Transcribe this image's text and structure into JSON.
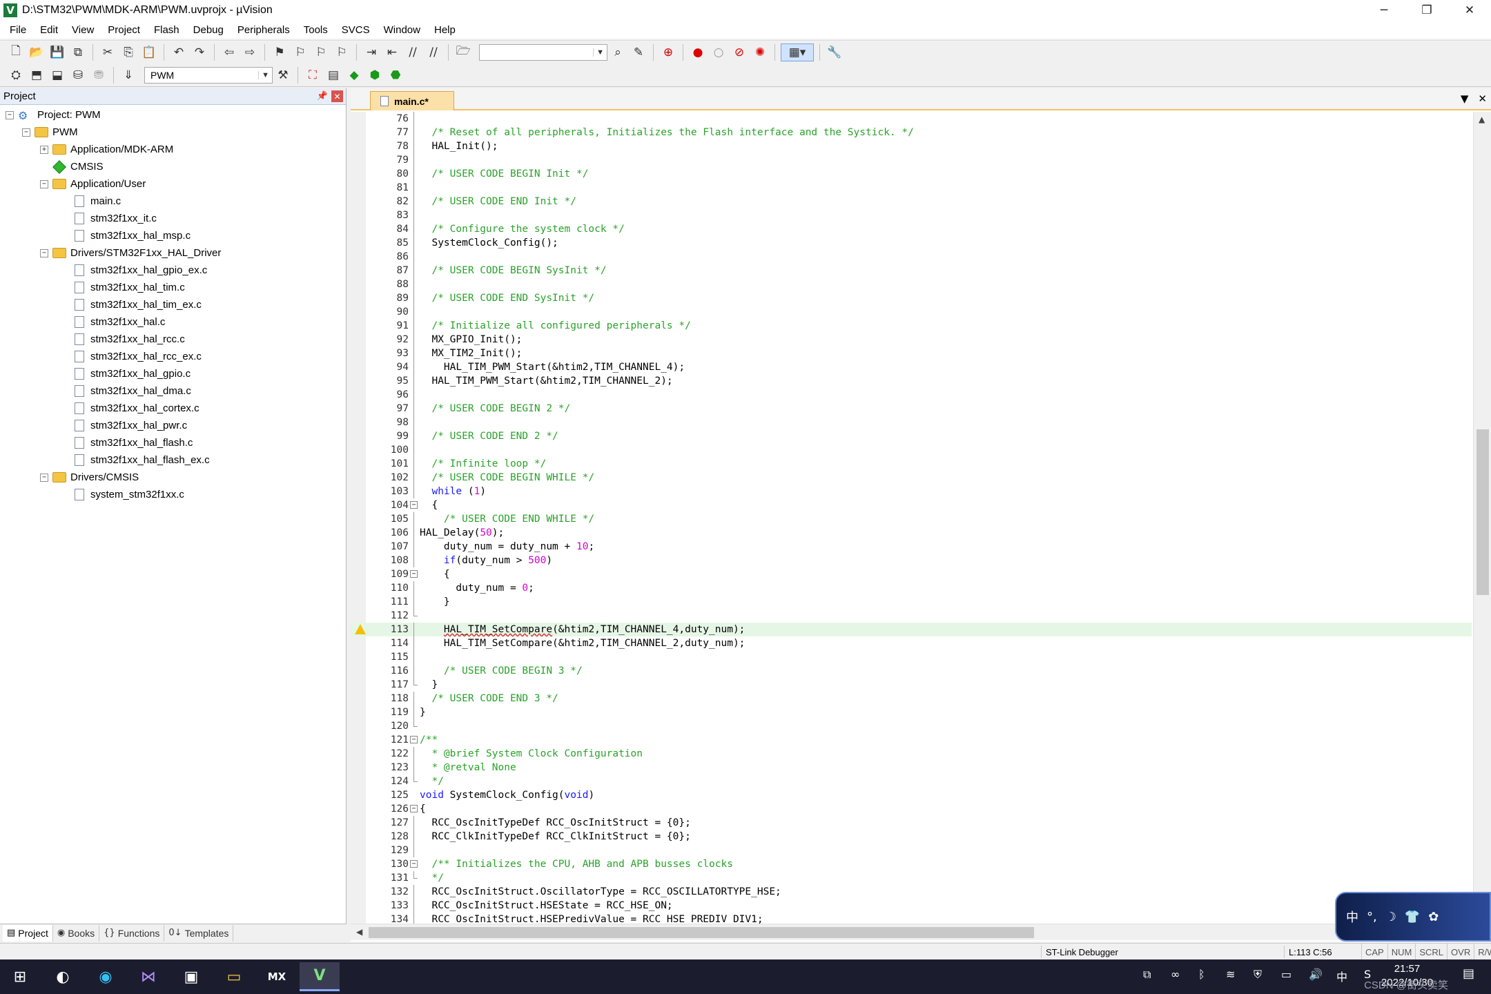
{
  "window": {
    "title": "D:\\STM32\\PWM\\MDK-ARM\\PWM.uvprojx - µVision",
    "app_icon": "V",
    "minimize": "─",
    "restore": "❐",
    "close": "✕"
  },
  "menu": [
    "File",
    "Edit",
    "View",
    "Project",
    "Flash",
    "Debug",
    "Peripherals",
    "Tools",
    "SVCS",
    "Window",
    "Help"
  ],
  "toolbar2": {
    "target": "PWM"
  },
  "project_panel": {
    "title": "Project",
    "tree": [
      {
        "label": "Project: PWM",
        "level": 0,
        "kind": "project",
        "exp": "−"
      },
      {
        "label": "PWM",
        "level": 1,
        "kind": "folder",
        "exp": "−"
      },
      {
        "label": "Application/MDK-ARM",
        "level": 2,
        "kind": "folder",
        "exp": "+"
      },
      {
        "label": "CMSIS",
        "level": 2,
        "kind": "cmsis",
        "exp": ""
      },
      {
        "label": "Application/User",
        "level": 2,
        "kind": "folder",
        "exp": "−"
      },
      {
        "label": "main.c",
        "level": 3,
        "kind": "file",
        "exp": ""
      },
      {
        "label": "stm32f1xx_it.c",
        "level": 3,
        "kind": "file",
        "exp": ""
      },
      {
        "label": "stm32f1xx_hal_msp.c",
        "level": 3,
        "kind": "file",
        "exp": ""
      },
      {
        "label": "Drivers/STM32F1xx_HAL_Driver",
        "level": 2,
        "kind": "folder",
        "exp": "−"
      },
      {
        "label": "stm32f1xx_hal_gpio_ex.c",
        "level": 3,
        "kind": "file",
        "exp": ""
      },
      {
        "label": "stm32f1xx_hal_tim.c",
        "level": 3,
        "kind": "file",
        "exp": ""
      },
      {
        "label": "stm32f1xx_hal_tim_ex.c",
        "level": 3,
        "kind": "file",
        "exp": ""
      },
      {
        "label": "stm32f1xx_hal.c",
        "level": 3,
        "kind": "file",
        "exp": ""
      },
      {
        "label": "stm32f1xx_hal_rcc.c",
        "level": 3,
        "kind": "file",
        "exp": ""
      },
      {
        "label": "stm32f1xx_hal_rcc_ex.c",
        "level": 3,
        "kind": "file",
        "exp": ""
      },
      {
        "label": "stm32f1xx_hal_gpio.c",
        "level": 3,
        "kind": "file",
        "exp": ""
      },
      {
        "label": "stm32f1xx_hal_dma.c",
        "level": 3,
        "kind": "file",
        "exp": ""
      },
      {
        "label": "stm32f1xx_hal_cortex.c",
        "level": 3,
        "kind": "file",
        "exp": ""
      },
      {
        "label": "stm32f1xx_hal_pwr.c",
        "level": 3,
        "kind": "file",
        "exp": ""
      },
      {
        "label": "stm32f1xx_hal_flash.c",
        "level": 3,
        "kind": "file",
        "exp": ""
      },
      {
        "label": "stm32f1xx_hal_flash_ex.c",
        "level": 3,
        "kind": "file",
        "exp": ""
      },
      {
        "label": "Drivers/CMSIS",
        "level": 2,
        "kind": "folder",
        "exp": "−"
      },
      {
        "label": "system_stm32f1xx.c",
        "level": 3,
        "kind": "file",
        "exp": ""
      }
    ],
    "tabs": [
      {
        "label": "Project",
        "icon": "▤"
      },
      {
        "label": "Books",
        "icon": "◉"
      },
      {
        "label": "Functions",
        "icon": "{}"
      },
      {
        "label": "Templates",
        "icon": "0↓"
      }
    ]
  },
  "editor": {
    "tab_label": "main.c*",
    "lines": [
      {
        "n": "76",
        "t": "",
        "c": "code",
        "f": "line"
      },
      {
        "n": "77",
        "t": "  /* Reset of all peripherals, Initializes the Flash interface and the Systick. */",
        "c": "cmt",
        "f": "line"
      },
      {
        "n": "78",
        "t": "  HAL_Init();",
        "c": "code",
        "f": "line"
      },
      {
        "n": "79",
        "t": "",
        "c": "code",
        "f": "line"
      },
      {
        "n": "80",
        "t": "  /* USER CODE BEGIN Init */",
        "c": "cmt",
        "f": "line"
      },
      {
        "n": "81",
        "t": "",
        "c": "code",
        "f": "line"
      },
      {
        "n": "82",
        "t": "  /* USER CODE END Init */",
        "c": "cmt",
        "f": "line"
      },
      {
        "n": "83",
        "t": "",
        "c": "code",
        "f": "line"
      },
      {
        "n": "84",
        "t": "  /* Configure the system clock */",
        "c": "cmt",
        "f": "line"
      },
      {
        "n": "85",
        "t": "  SystemClock_Config();",
        "c": "code",
        "f": "line"
      },
      {
        "n": "86",
        "t": "",
        "c": "code",
        "f": "line"
      },
      {
        "n": "87",
        "t": "  /* USER CODE BEGIN SysInit */",
        "c": "cmt",
        "f": "line"
      },
      {
        "n": "88",
        "t": "",
        "c": "code",
        "f": "line"
      },
      {
        "n": "89",
        "t": "  /* USER CODE END SysInit */",
        "c": "cmt",
        "f": "line"
      },
      {
        "n": "90",
        "t": "",
        "c": "code",
        "f": "line"
      },
      {
        "n": "91",
        "t": "  /* Initialize all configured peripherals */",
        "c": "cmt",
        "f": "line"
      },
      {
        "n": "92",
        "t": "  MX_GPIO_Init();",
        "c": "code",
        "f": "line"
      },
      {
        "n": "93",
        "t": "  MX_TIM2_Init();",
        "c": "code",
        "f": "line"
      },
      {
        "n": "94",
        "t": "    HAL_TIM_PWM_Start(&htim2,TIM_CHANNEL_4);",
        "c": "code",
        "f": "line"
      },
      {
        "n": "95",
        "t": "  HAL_TIM_PWM_Start(&htim2,TIM_CHANNEL_2);",
        "c": "code",
        "f": "line"
      },
      {
        "n": "96",
        "t": "",
        "c": "code",
        "f": "line"
      },
      {
        "n": "97",
        "t": "  /* USER CODE BEGIN 2 */",
        "c": "cmt",
        "f": "line"
      },
      {
        "n": "98",
        "t": "",
        "c": "code",
        "f": "line"
      },
      {
        "n": "99",
        "t": "  /* USER CODE END 2 */",
        "c": "cmt",
        "f": "line"
      },
      {
        "n": "100",
        "t": "",
        "c": "code",
        "f": "line"
      },
      {
        "n": "101",
        "t": "  /* Infinite loop */",
        "c": "cmt",
        "f": "line"
      },
      {
        "n": "102",
        "t": "  /* USER CODE BEGIN WHILE */",
        "c": "cmt",
        "f": "line"
      },
      {
        "n": "103",
        "t": "  while (1)",
        "c": "code",
        "f": "line"
      },
      {
        "n": "104",
        "t": "  {",
        "c": "code",
        "f": "box"
      },
      {
        "n": "105",
        "t": "    /* USER CODE END WHILE */",
        "c": "cmt",
        "f": "line"
      },
      {
        "n": "106",
        "t": "HAL_Delay(50);",
        "c": "code",
        "f": "line"
      },
      {
        "n": "107",
        "t": "    duty_num = duty_num + 10;",
        "c": "code",
        "f": "line"
      },
      {
        "n": "108",
        "t": "    if(duty_num > 500)",
        "c": "code",
        "f": "line"
      },
      {
        "n": "109",
        "t": "    {",
        "c": "code",
        "f": "box"
      },
      {
        "n": "110",
        "t": "      duty_num = 0;",
        "c": "code",
        "f": "line"
      },
      {
        "n": "111",
        "t": "    }",
        "c": "code",
        "f": "line"
      },
      {
        "n": "112",
        "t": "",
        "c": "code",
        "f": "end"
      },
      {
        "n": "113",
        "t": "    HAL_TIM_SetCompare(&htim2,TIM_CHANNEL_4,duty_num);",
        "c": "code",
        "f": "line",
        "hl": true,
        "warn": true
      },
      {
        "n": "114",
        "t": "    HAL_TIM_SetCompare(&htim2,TIM_CHANNEL_2,duty_num);",
        "c": "code",
        "f": "line"
      },
      {
        "n": "115",
        "t": "",
        "c": "code",
        "f": "line"
      },
      {
        "n": "116",
        "t": "    /* USER CODE BEGIN 3 */",
        "c": "cmt",
        "f": "line"
      },
      {
        "n": "117",
        "t": "  }",
        "c": "code",
        "f": "end"
      },
      {
        "n": "118",
        "t": "  /* USER CODE END 3 */",
        "c": "cmt",
        "f": "line"
      },
      {
        "n": "119",
        "t": "}",
        "c": "code",
        "f": "line"
      },
      {
        "n": "120",
        "t": "",
        "c": "code",
        "f": "end"
      },
      {
        "n": "121",
        "t": "/**",
        "c": "cmt",
        "f": "box"
      },
      {
        "n": "122",
        "t": "  * @brief System Clock Configuration",
        "c": "cmt",
        "f": "line"
      },
      {
        "n": "123",
        "t": "  * @retval None",
        "c": "cmt",
        "f": "line"
      },
      {
        "n": "124",
        "t": "  */",
        "c": "cmt",
        "f": "end"
      },
      {
        "n": "125",
        "t": "void SystemClock_Config(void)",
        "c": "code",
        "f": ""
      },
      {
        "n": "126",
        "t": "{",
        "c": "code",
        "f": "box"
      },
      {
        "n": "127",
        "t": "  RCC_OscInitTypeDef RCC_OscInitStruct = {0};",
        "c": "code",
        "f": "line"
      },
      {
        "n": "128",
        "t": "  RCC_ClkInitTypeDef RCC_ClkInitStruct = {0};",
        "c": "code",
        "f": "line"
      },
      {
        "n": "129",
        "t": "",
        "c": "code",
        "f": "line"
      },
      {
        "n": "130",
        "t": "  /** Initializes the CPU, AHB and APB busses clocks",
        "c": "cmt",
        "f": "box"
      },
      {
        "n": "131",
        "t": "  */",
        "c": "cmt",
        "f": "end"
      },
      {
        "n": "132",
        "t": "  RCC_OscInitStruct.OscillatorType = RCC_OSCILLATORTYPE_HSE;",
        "c": "code",
        "f": "line"
      },
      {
        "n": "133",
        "t": "  RCC_OscInitStruct.HSEState = RCC_HSE_ON;",
        "c": "code",
        "f": "line"
      },
      {
        "n": "134",
        "t": "  RCC_OscInitStruct.HSEPredivValue = RCC_HSE_PREDIV_DIV1;",
        "c": "code",
        "f": "line"
      }
    ]
  },
  "ime_widget": [
    "中",
    "°,",
    "☽",
    "👕",
    "✿"
  ],
  "statusbar": {
    "debugger": "ST-Link Debugger",
    "position": "L:113 C:56",
    "indicators": [
      "CAP",
      "NUM",
      "SCRL",
      "OVR",
      "R/W"
    ]
  },
  "taskbar": {
    "apps": [
      {
        "name": "start",
        "icon": "⊞"
      },
      {
        "name": "app",
        "icon": "◐"
      },
      {
        "name": "edge",
        "icon": "◉"
      },
      {
        "name": "visual-studio",
        "icon": "⋈"
      },
      {
        "name": "printer",
        "icon": "▣"
      },
      {
        "name": "file-explorer",
        "icon": "▭"
      },
      {
        "name": "stm32cubemx",
        "icon": "MX"
      },
      {
        "name": "keil-uvision",
        "icon": "V"
      }
    ],
    "tray": [
      "⧉",
      "∞",
      "ᛒ",
      "≋",
      "⛨",
      "▭",
      "🔊",
      "中",
      "S"
    ],
    "time": "21:57",
    "date": "2022/10/30",
    "watermark": "CSDN @街头卖笑",
    "notify_icon": "▤"
  }
}
